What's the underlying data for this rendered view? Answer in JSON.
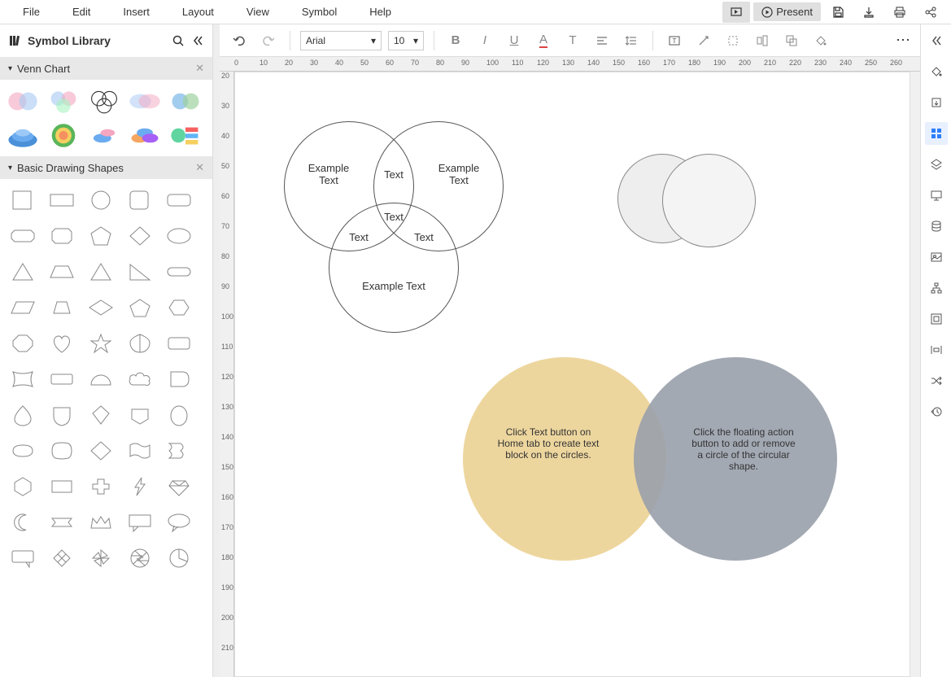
{
  "menu": {
    "items": [
      "File",
      "Edit",
      "Insert",
      "Layout",
      "View",
      "Symbol",
      "Help"
    ],
    "present": "Present"
  },
  "library": {
    "title": "Symbol Library",
    "sections": {
      "venn": "Venn Chart",
      "basic": "Basic Drawing Shapes"
    }
  },
  "toolbar": {
    "font": "Arial",
    "size": "10"
  },
  "ruler_h": [
    "0",
    "10",
    "20",
    "30",
    "40",
    "50",
    "60",
    "70",
    "80",
    "90",
    "100",
    "110",
    "120",
    "130",
    "140",
    "150",
    "160",
    "170",
    "180",
    "190",
    "200",
    "210",
    "220",
    "230",
    "240",
    "250",
    "260"
  ],
  "ruler_v": [
    "20",
    "30",
    "40",
    "50",
    "60",
    "70",
    "80",
    "90",
    "100",
    "110",
    "120",
    "130",
    "140",
    "150",
    "160",
    "170",
    "180",
    "190",
    "200",
    "210"
  ],
  "venn1": {
    "c1": "Example Text",
    "c2": "Example Text",
    "c3": "Example Text",
    "o12": "Text",
    "o13": "Text",
    "o23": "Text",
    "center": "Text"
  },
  "venn_big": {
    "left": "Click Text button on Home tab to create text block on the circles.",
    "right": "Click the floating action button to add or remove a circle of the circular shape."
  }
}
